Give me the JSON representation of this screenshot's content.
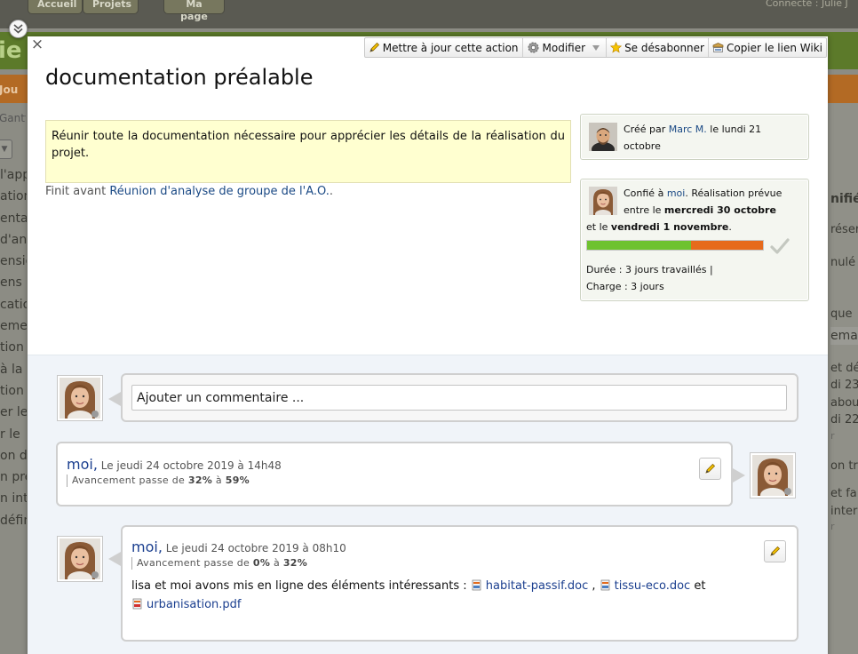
{
  "background": {
    "nav_tabs": [
      "Accueil",
      "Projets",
      "Ma page"
    ],
    "connected_text": "Connecté : Julie J",
    "project_title_fragment": "ie",
    "orange_bar_text": "Jou",
    "gantt_text": "Gantt",
    "left_items": [
      "l'app",
      "ation",
      "enta",
      "d'ana",
      "ensio",
      "ens",
      "cation",
      "emen",
      "tion",
      "à la",
      "tion",
      "er le",
      "r le",
      "on de",
      "n pré",
      "n inte",
      "défin"
    ],
    "right_items": [
      "nifié",
      "réser",
      "nulé",
      "que",
      "emai",
      "et dé",
      "di 23",
      "abou",
      "di 22",
      "r",
      "on tr",
      "et fa",
      "inter",
      "r"
    ]
  },
  "toolbar": {
    "update_label": "Mettre à jour cette action",
    "modify_label": "Modifier",
    "unsubscribe_label": "Se désabonner",
    "copy_wiki_label": "Copier le lien Wiki"
  },
  "dialog": {
    "title": "documentation préalable",
    "description": "Réunir toute la documentation nécessaire pour apprécier les détails de la réalisation du projet.",
    "finish_before_label": "Finit avant",
    "finish_before_link": "Réunion d'analyse de groupe de l'A.O.",
    "finish_before_suffix": "."
  },
  "created_card": {
    "prefix": "Créé par",
    "author": "Marc M.",
    "date_text": "le lundi 21 octobre"
  },
  "assign_card": {
    "prefix": "Confié à",
    "assignee": "moi",
    "planned_text": ". Réalisation prévue entre le",
    "start_date": "mercredi 30 octobre",
    "and_text": "et le",
    "end_date": "vendredi 1 novembre",
    "end_punct": ".",
    "progress": 0.59,
    "duration_text": "Durée : 3 jours travaillés |",
    "workload_text": "Charge : 3 jours"
  },
  "comments": {
    "input_placeholder": "Ajouter un commentaire ...",
    "items": [
      {
        "author": "moi",
        "separator": ",",
        "date": "Le jeudi 24 octobre 2019 à 14h48",
        "progress_prefix": "Avancement passe de",
        "progress_from": "32%",
        "progress_to_word": "à",
        "progress_to": "59%"
      },
      {
        "author": "moi",
        "separator": ",",
        "date": "Le jeudi 24 octobre 2019 à 08h10",
        "progress_prefix": "Avancement passe de",
        "progress_from": "0%",
        "progress_to_word": "à",
        "progress_to": "32%",
        "body_prefix": "lisa et moi avons mis en ligne des éléments intéressants :",
        "files": [
          "habitat-passif.doc",
          "tissu-eco.doc",
          "urbanisation.pdf"
        ],
        "file_sep_1": ",",
        "file_sep_2": "et"
      }
    ]
  },
  "colors": {
    "progress_done": "#6ec22f",
    "progress_remaining": "#e66a1c",
    "description_bg": "#ffffd0",
    "link": "#1b4a85"
  }
}
